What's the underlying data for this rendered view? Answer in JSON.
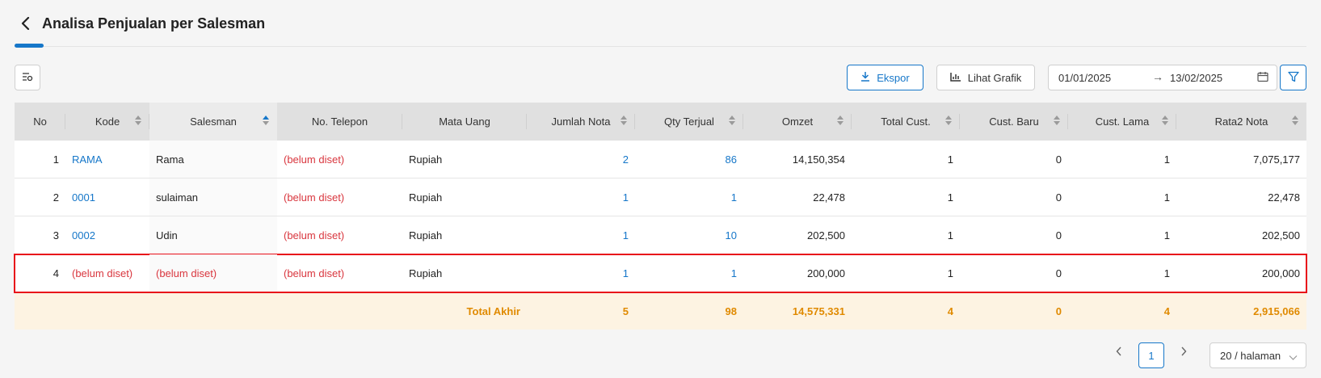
{
  "header": {
    "title": "Analisa Penjualan per Salesman"
  },
  "toolbar": {
    "export_label": "Ekspor",
    "chart_label": "Lihat Grafik",
    "date_start": "01/01/2025",
    "date_end": "13/02/2025",
    "accent": "#1677c9"
  },
  "table": {
    "columns": [
      "No",
      "Kode",
      "Salesman",
      "No. Telepon",
      "Mata Uang",
      "Jumlah Nota",
      "Qty Terjual",
      "Omzet",
      "Total Cust.",
      "Cust. Baru",
      "Cust. Lama",
      "Rata2 Nota"
    ],
    "rows": [
      {
        "no": "1",
        "kode": "RAMA",
        "salesman": "Rama",
        "telp": "(belum diset)",
        "mata": "Rupiah",
        "jml": "2",
        "qty": "86",
        "omzet": "14,150,354",
        "tc": "1",
        "cb": "0",
        "cl": "1",
        "rata": "7,075,177"
      },
      {
        "no": "2",
        "kode": "0001",
        "salesman": "sulaiman",
        "telp": "(belum diset)",
        "mata": "Rupiah",
        "jml": "1",
        "qty": "1",
        "omzet": "22,478",
        "tc": "1",
        "cb": "0",
        "cl": "1",
        "rata": "22,478"
      },
      {
        "no": "3",
        "kode": "0002",
        "salesman": "Udin",
        "telp": "(belum diset)",
        "mata": "Rupiah",
        "jml": "1",
        "qty": "10",
        "omzet": "202,500",
        "tc": "1",
        "cb": "0",
        "cl": "1",
        "rata": "202,500"
      },
      {
        "no": "4",
        "kode": "(belum diset)",
        "salesman": "(belum diset)",
        "telp": "(belum diset)",
        "mata": "Rupiah",
        "jml": "1",
        "qty": "1",
        "omzet": "200,000",
        "tc": "1",
        "cb": "0",
        "cl": "1",
        "rata": "200,000"
      }
    ],
    "total": {
      "label": "Total Akhir",
      "jml": "5",
      "qty": "98",
      "omzet": "14,575,331",
      "tc": "4",
      "cb": "0",
      "cl": "4",
      "rata": "2,915,066"
    }
  },
  "pagination": {
    "current_page": "1",
    "page_size": "20 / halaman"
  },
  "colors": {
    "unset_text": "#d9363e",
    "total_text": "#e08a00",
    "total_bg": "#fdf3e2",
    "highlight": "#e8101a"
  },
  "icons": [
    "back-icon",
    "column-settings-icon",
    "download-icon",
    "bar-chart-icon",
    "calendar-icon",
    "filter-icon",
    "sort-icon",
    "chevron-left-icon",
    "chevron-right-icon",
    "chevron-down-icon"
  ]
}
